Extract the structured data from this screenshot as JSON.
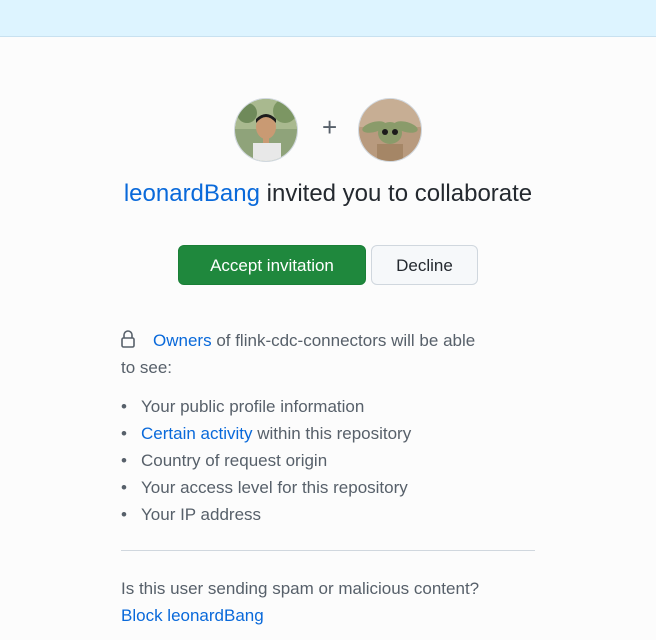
{
  "header": {
    "inviter": "leonardBang",
    "invite_text": "invited you to collaborate",
    "plus": "+"
  },
  "actions": {
    "accept_label": "Accept invitation",
    "decline_label": "Decline"
  },
  "visibility": {
    "owners_link": "Owners",
    "text_after": "of flink-cdc-connectors will be able",
    "text_line2": "to see:",
    "items": [
      {
        "link": "",
        "text": "Your public profile information"
      },
      {
        "link": "Certain activity",
        "text": "within this repository"
      },
      {
        "link": "",
        "text": "Country of request origin"
      },
      {
        "link": "",
        "text": "Your access level for this repository"
      },
      {
        "link": "",
        "text": "Your IP address"
      }
    ]
  },
  "report": {
    "question": "Is this user sending spam or malicious content?",
    "block_label": "Block leonardBang"
  },
  "icons": {
    "lock": "lock-icon",
    "avatar_left": "user-avatar",
    "avatar_right": "repo-avatar"
  },
  "colors": {
    "accent_link": "#0969da",
    "accept_button": "#1f883d",
    "top_band": "#ddf4ff"
  }
}
